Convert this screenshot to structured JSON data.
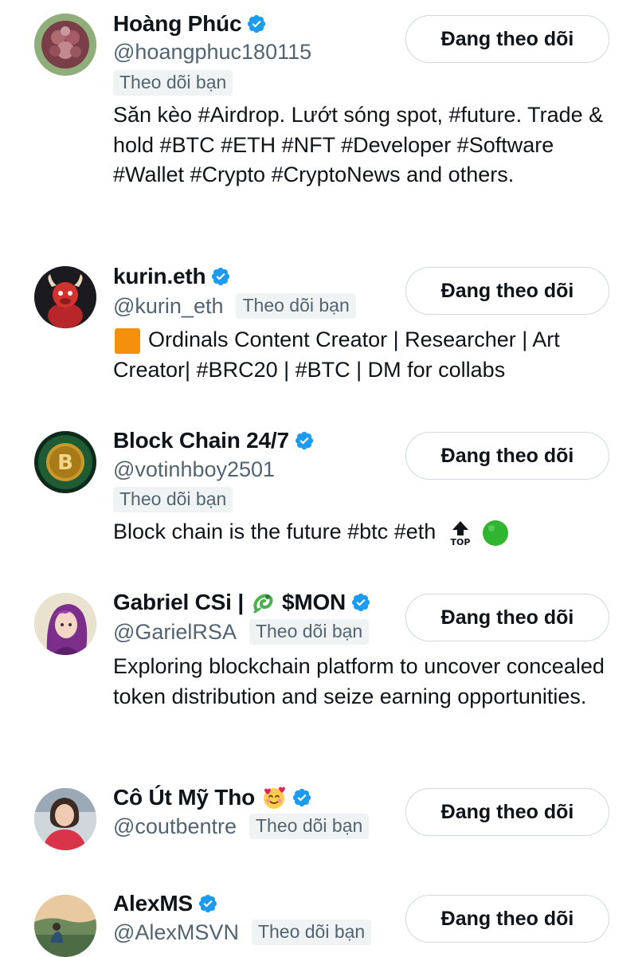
{
  "users": [
    {
      "name": "Hoàng Phúc",
      "handle": "@hoangphuc180115",
      "follows_you": "Theo dõi bạn",
      "button": "Đang theo dõi",
      "bio": "Săn kèo #Airdrop. Lướt sóng spot, #future. Trade & hold #BTC #ETH #NFT #Developer #Software #Wallet #Crypto #CryptoNews and others.",
      "avatar_icon": "flower-avatar"
    },
    {
      "name": "kurin.eth",
      "handle": "@kurin_eth",
      "follows_you": "Theo dõi bạn",
      "button": "Đang theo dõi",
      "bio_emoji": "orange-square-emoji",
      "bio": "Ordinals Content Creator | Researcher | Art Creator| #BRC20 | #BTC | DM for collabs",
      "avatar_icon": "red-bull-avatar"
    },
    {
      "name": "Block Chain 24/7",
      "handle": "@votinhboy2501",
      "follows_you": "Theo dõi bạn",
      "button": "Đang theo dõi",
      "bio": "Block chain is the future #btc #eth",
      "bio_trailing_emojis": [
        "top-arrow-emoji",
        "green-circle-emoji"
      ],
      "avatar_icon": "bitcoin-coin-avatar"
    },
    {
      "name_prefix": "Gabriel CSi |",
      "name_suffix": "$MON",
      "name_emoji": "dragon-emoji",
      "handle": "@GarielRSA",
      "follows_you": "Theo dõi bạn",
      "button": "Đang theo dõi",
      "bio": "Exploring blockchain platform to uncover concealed token distribution and seize earning opportunities.",
      "avatar_icon": "anime-girl-avatar"
    },
    {
      "name": "Cô Út Mỹ Tho",
      "name_emoji": "smiling-face-with-hearts-emoji",
      "handle": "@coutbentre",
      "follows_you": "Theo dõi bạn",
      "button": "Đang theo dõi",
      "avatar_icon": "woman-photo-avatar"
    },
    {
      "name": "AlexMS",
      "handle": "@AlexMSVN",
      "follows_you": "Theo dõi bạn",
      "button": "Đang theo dõi",
      "avatar_icon": "landscape-photo-avatar"
    }
  ],
  "colors": {
    "verified": "#1d9bf0",
    "text_primary": "#0f1419",
    "text_secondary": "#536471",
    "badge_bg": "#eff3f4",
    "button_border": "#cfd9de"
  }
}
